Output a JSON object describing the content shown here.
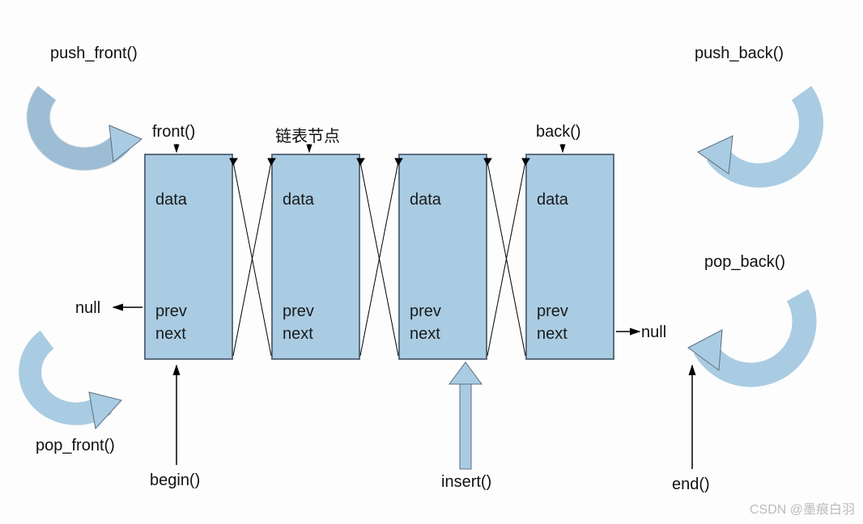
{
  "operations": {
    "push_front": "push_front()",
    "pop_front": "pop_front()",
    "push_back": "push_back()",
    "pop_back": "pop_back()"
  },
  "node_headers": {
    "front": "front()",
    "list_node": "链表节点",
    "back": "back()"
  },
  "node_fields": {
    "data": "data",
    "prev": "prev",
    "next": "next"
  },
  "null_label": "null",
  "bottom_labels": {
    "begin": "begin()",
    "insert": "insert()",
    "end": "end()"
  },
  "watermark": "CSDN @墨痕白羽",
  "chart_data": {
    "type": "diagram",
    "description": "Doubly-linked list with four nodes showing data/prev/next fields. Crossing pointer lines connect adjacent nodes. First node's prev points to null on the left; last node's next points to null on the right. Operations push_front/pop_front shown on left with curved arrows, push_back/pop_back on right. begin() points to first node, insert() points to third node, end() points past last node.",
    "nodes": [
      {
        "role": "front",
        "header": "front()",
        "fields": [
          "data",
          "prev",
          "next"
        ]
      },
      {
        "role": "middle",
        "header": "链表节点",
        "fields": [
          "data",
          "prev",
          "next"
        ]
      },
      {
        "role": "middle",
        "header": "",
        "fields": [
          "data",
          "prev",
          "next"
        ]
      },
      {
        "role": "back",
        "header": "back()",
        "fields": [
          "data",
          "prev",
          "next"
        ]
      }
    ],
    "left_null": true,
    "right_null": true,
    "bottom_pointers": [
      "begin()",
      "insert()",
      "end()"
    ],
    "left_ops": [
      "push_front()",
      "pop_front()"
    ],
    "right_ops": [
      "push_back()",
      "pop_back()"
    ]
  }
}
